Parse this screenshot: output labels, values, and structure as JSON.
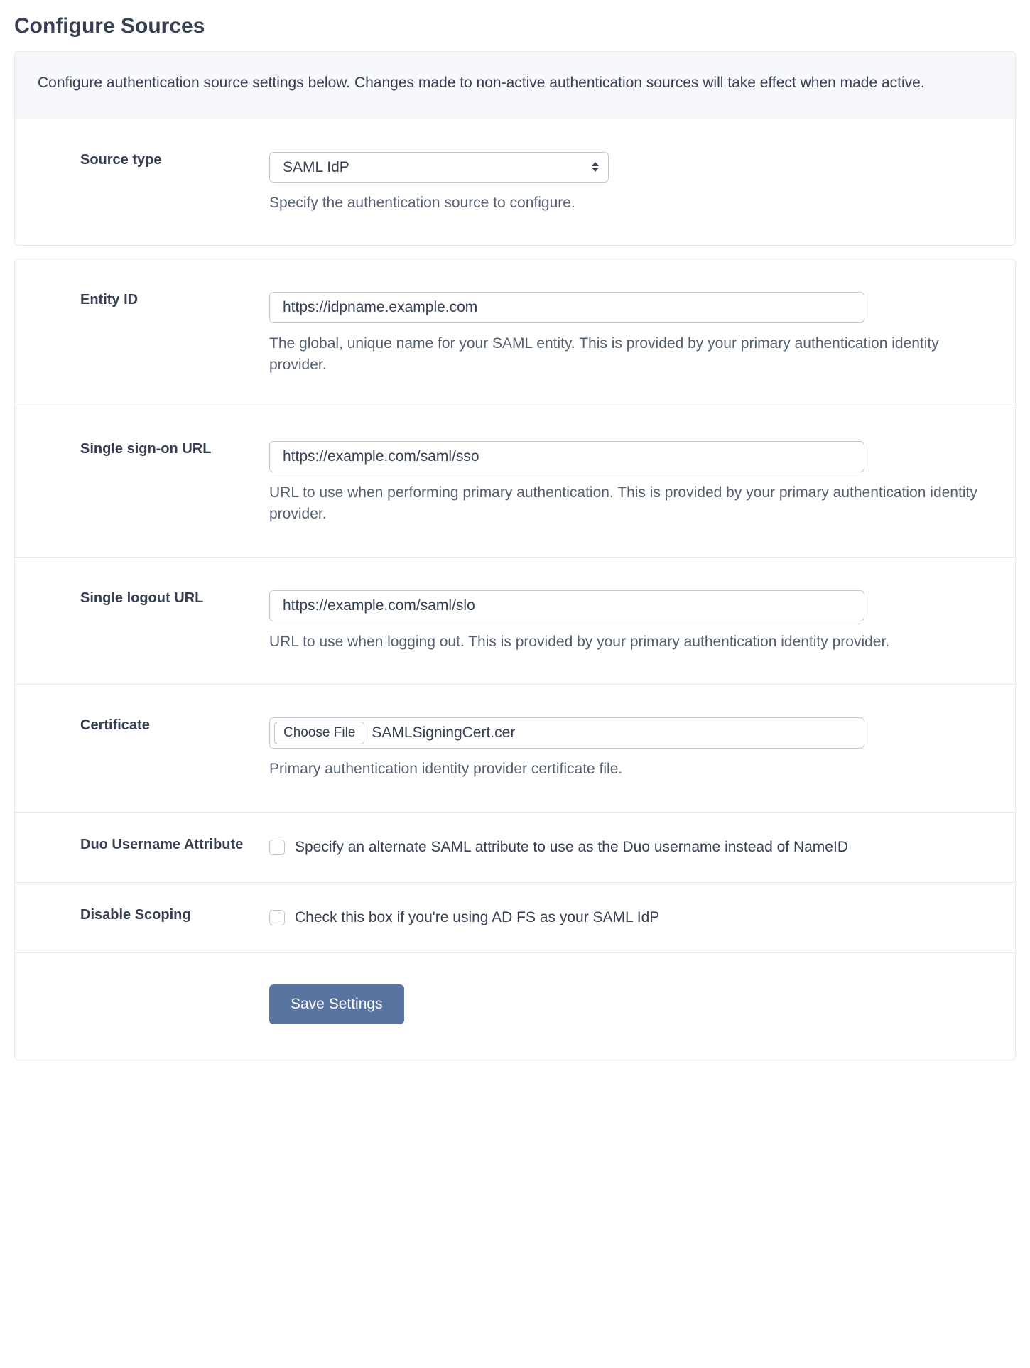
{
  "heading": "Configure Sources",
  "description": "Configure authentication source settings below. Changes made to non-active authentication sources will take effect when made active.",
  "fields": {
    "source_type": {
      "label": "Source type",
      "value": "SAML IdP",
      "help": "Specify the authentication source to configure."
    },
    "entity_id": {
      "label": "Entity ID",
      "value": "https://idpname.example.com",
      "help": "The global, unique name for your SAML entity. This is provided by your primary authentication identity provider."
    },
    "sso_url": {
      "label": "Single sign-on URL",
      "value": "https://example.com/saml/sso",
      "help": "URL to use when performing primary authentication. This is provided by your primary authentication identity provider."
    },
    "slo_url": {
      "label": "Single logout URL",
      "value": "https://example.com/saml/slo",
      "help": "URL to use when logging out. This is provided by your primary authentication identity provider."
    },
    "certificate": {
      "label": "Certificate",
      "button": "Choose File",
      "filename": "SAMLSigningCert.cer",
      "help": "Primary authentication identity provider certificate file."
    },
    "duo_user_attr": {
      "label": "Duo Username Attribute",
      "text": "Specify an alternate SAML attribute to use as the Duo username instead of NameID"
    },
    "disable_scoping": {
      "label": "Disable Scoping",
      "text": "Check this box if you're using AD FS as your SAML IdP"
    }
  },
  "submit_label": "Save Settings"
}
